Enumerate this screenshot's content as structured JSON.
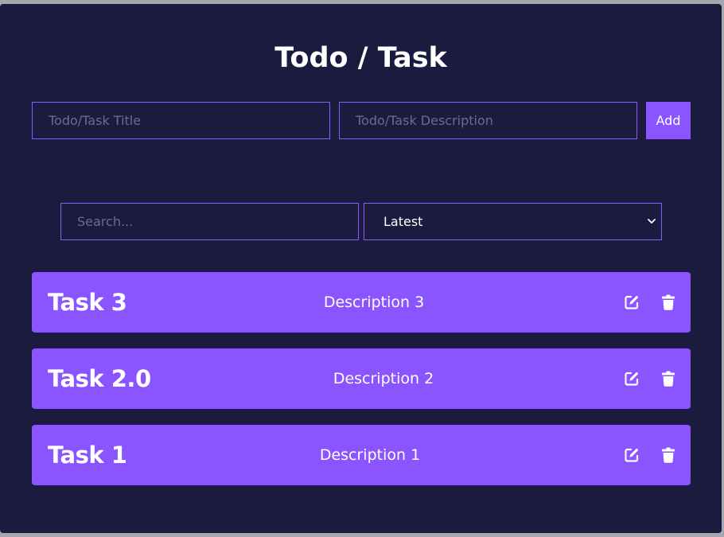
{
  "header": {
    "title": "Todo / Task"
  },
  "form": {
    "title_placeholder": "Todo/Task Title",
    "title_value": "",
    "description_placeholder": "Todo/Task Description",
    "description_value": "",
    "add_label": "Add"
  },
  "filter": {
    "search_placeholder": "Search...",
    "search_value": "",
    "sort_selected": "Latest"
  },
  "tasks": [
    {
      "title": "Task 3",
      "description": "Description 3"
    },
    {
      "title": "Task 2.0",
      "description": "Description 2"
    },
    {
      "title": "Task 1",
      "description": "Description 1"
    }
  ],
  "icons": {
    "edit": "edit-icon",
    "delete": "trash-icon",
    "dropdown": "chevron-down-icon"
  },
  "colors": {
    "background": "#1b1b3f",
    "accent": "#8a55ff",
    "border": "#8b5cf6",
    "text": "#ffffff"
  }
}
